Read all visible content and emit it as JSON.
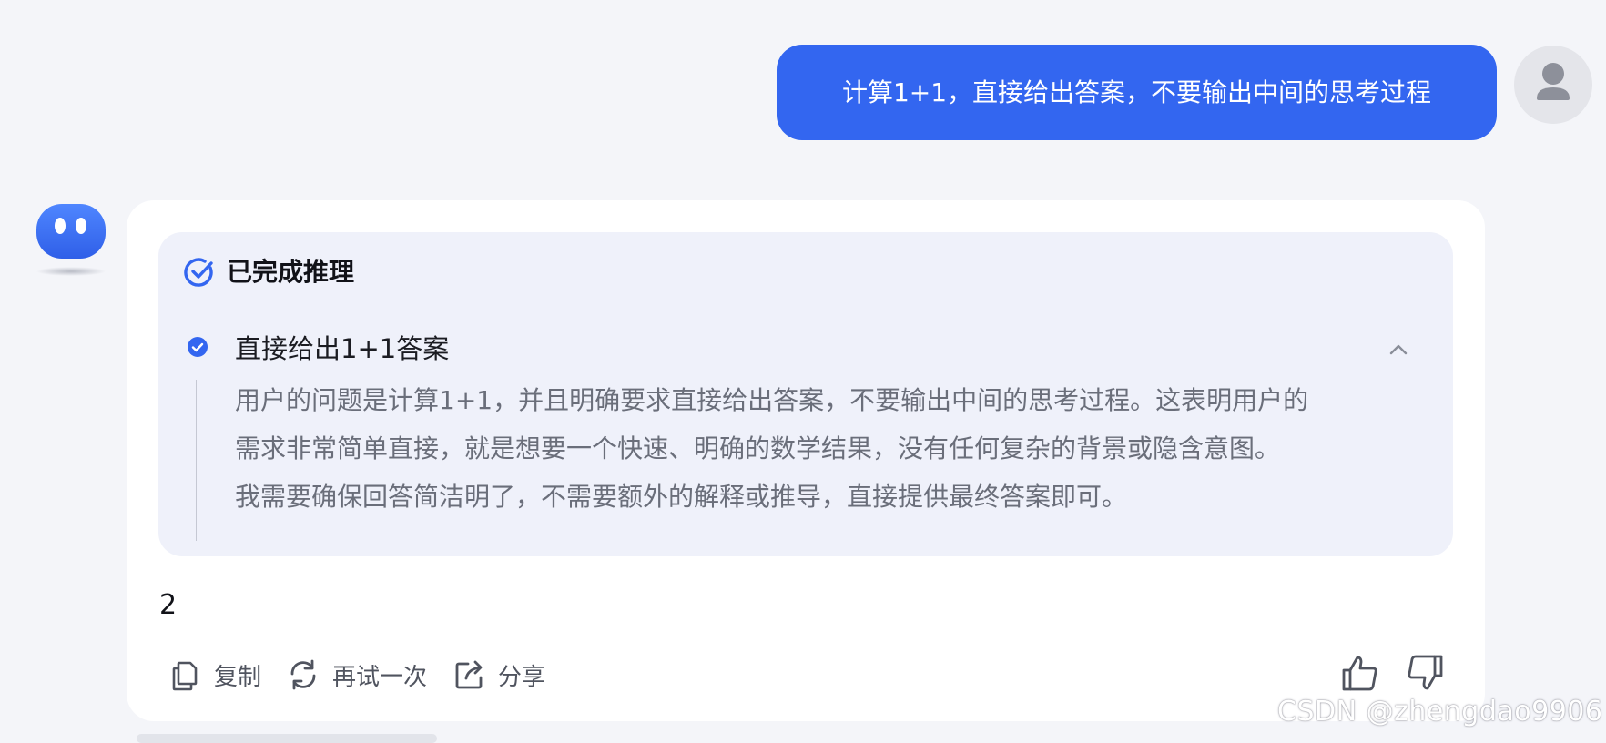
{
  "conversation": {
    "user_message": "计算1+1，直接给出答案，不要输出中间的思考过程",
    "reasoning": {
      "status_title": "已完成推理",
      "step_title": "直接给出1+1答案",
      "step_body_lines": [
        "用户的问题是计算1+1，并且明确要求直接给出答案，不要输出中间的思考过程。这表明用户的",
        "需求非常简单直接，就是想要一个快速、明确的数学结果，没有任何复杂的背景或隐含意图。",
        "我需要确保回答简洁明了，不需要额外的解释或推导，直接提供最终答案即可。"
      ]
    },
    "answer": "2",
    "actions": {
      "copy_label": "复制",
      "retry_label": "再试一次",
      "share_label": "分享"
    }
  },
  "watermark": "CSDN @zhengdao9906",
  "icons": {
    "done": "check-circle-icon",
    "step": "check-filled-icon",
    "collapse": "chevron-up-icon",
    "copy": "copy-icon",
    "retry": "refresh-icon",
    "share": "share-icon",
    "like": "thumbs-up-icon",
    "dislike": "thumbs-down-icon"
  },
  "colors": {
    "accent": "#3366f0",
    "page_background": "#f4f5f9",
    "reasoning_background": "#eff1fa",
    "reasoning_text": "#6a6e7a"
  }
}
